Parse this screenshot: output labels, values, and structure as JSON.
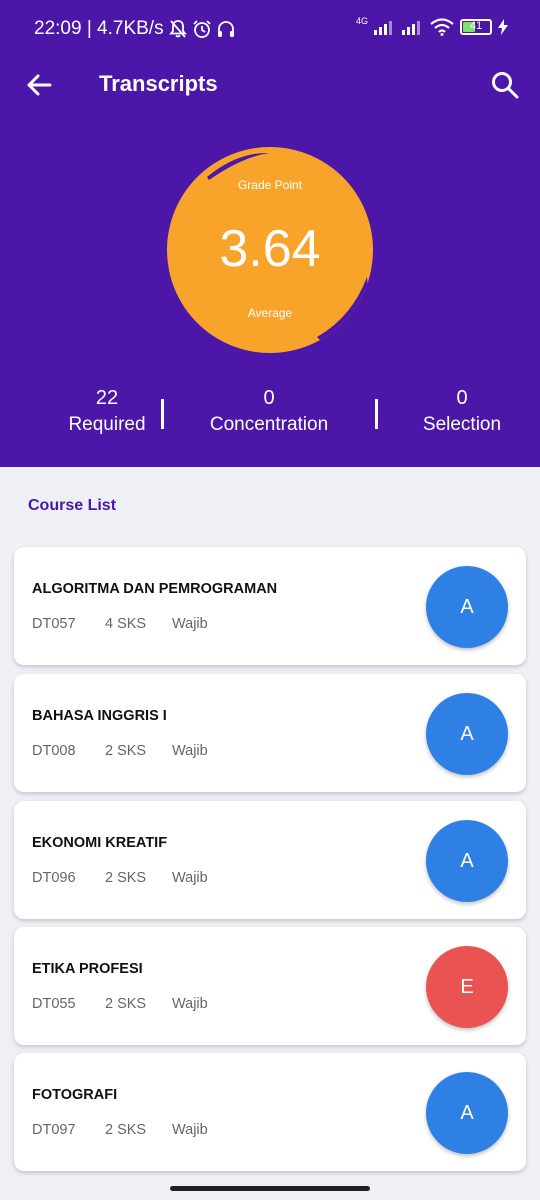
{
  "status_bar": {
    "text": "22:09 | 4.7KB/s",
    "network": "4G",
    "battery": "41"
  },
  "app_bar": {
    "title": "Transcripts"
  },
  "gpa": {
    "label_top": "Grade Point",
    "value": "3.64",
    "label_bottom": "Average",
    "color": "#f8a42a"
  },
  "stats": {
    "required": {
      "count": "22",
      "label": "Required"
    },
    "concentration": {
      "count": "0",
      "label": "Concentration"
    },
    "selection": {
      "count": "0",
      "label": "Selection"
    }
  },
  "section_title": "Course List",
  "colors": {
    "primary": "#4c17a8",
    "grade_a": "#2f80e5",
    "grade_e": "#e95453"
  },
  "courses": [
    {
      "name": "ALGORITMA DAN PEMROGRAMAN",
      "code": "DT057",
      "sks": "4 SKS",
      "type": "Wajib",
      "grade": "A"
    },
    {
      "name": "BAHASA INGGRIS I",
      "code": "DT008",
      "sks": "2 SKS",
      "type": "Wajib",
      "grade": "A"
    },
    {
      "name": "EKONOMI KREATIF",
      "code": "DT096",
      "sks": "2 SKS",
      "type": "Wajib",
      "grade": "A"
    },
    {
      "name": "ETIKA PROFESI",
      "code": "DT055",
      "sks": "2 SKS",
      "type": "Wajib",
      "grade": "E"
    },
    {
      "name": "FOTOGRAFI",
      "code": "DT097",
      "sks": "2 SKS",
      "type": "Wajib",
      "grade": "A"
    }
  ]
}
